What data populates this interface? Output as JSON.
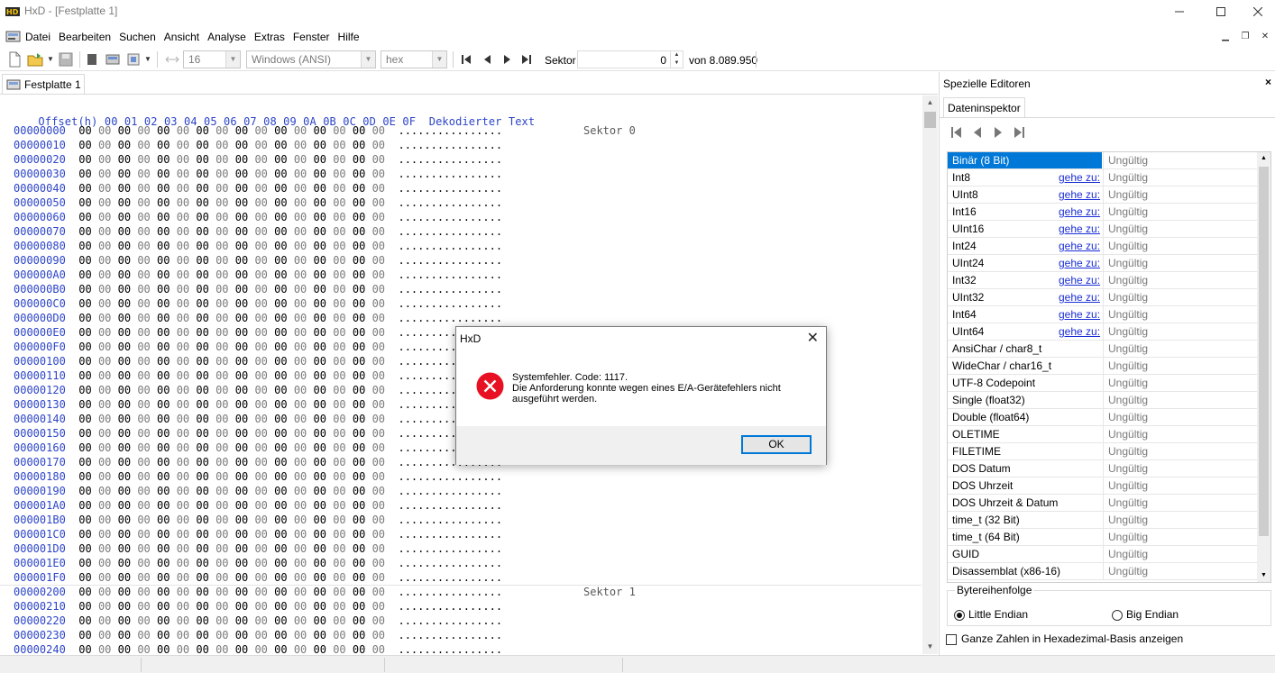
{
  "window": {
    "title": "HxD - [Festplatte 1]"
  },
  "colors": {
    "accent": "#0078d7",
    "offset_blue": "#2c44c8",
    "link_blue": "#1a2ed6",
    "error_red": "#e81123"
  },
  "menu": {
    "items": [
      "Datei",
      "Bearbeiten",
      "Suchen",
      "Ansicht",
      "Analyse",
      "Extras",
      "Fenster",
      "Hilfe"
    ]
  },
  "toolbar": {
    "bytes_per_row": "16",
    "charset": "Windows (ANSI)",
    "number_base": "hex",
    "sector_label": "Sektor",
    "sector_value": "0",
    "sector_total": "von 8.089.950"
  },
  "document_tab": {
    "label": "Festplatte 1"
  },
  "hex_view": {
    "header_offset": "Offset(h)",
    "header_columns": [
      "00",
      "01",
      "02",
      "03",
      "04",
      "05",
      "06",
      "07",
      "08",
      "09",
      "0A",
      "0B",
      "0C",
      "0D",
      "0E",
      "0F"
    ],
    "header_decoded": "Dekodierter Text",
    "byte_value": "00",
    "decoded_text": "................",
    "offsets": [
      "00000000",
      "00000010",
      "00000020",
      "00000030",
      "00000040",
      "00000050",
      "00000060",
      "00000070",
      "00000080",
      "00000090",
      "000000A0",
      "000000B0",
      "000000C0",
      "000000D0",
      "000000E0",
      "000000F0",
      "00000100",
      "00000110",
      "00000120",
      "00000130",
      "00000140",
      "00000150",
      "00000160",
      "00000170",
      "00000180",
      "00000190",
      "000001A0",
      "000001B0",
      "000001C0",
      "000001D0",
      "000001E0",
      "000001F0",
      "00000200",
      "00000210",
      "00000220",
      "00000230",
      "00000240"
    ],
    "sector_labels": [
      "Sektor 0",
      "Sektor 1"
    ]
  },
  "panel": {
    "title": "Spezielle Editoren",
    "close": "×",
    "tab": "Dateninspektor",
    "goto_label": "gehe zu:",
    "rows": [
      {
        "name": "Binär (8 Bit)",
        "value": "Ungültig",
        "selected": true,
        "goto": false
      },
      {
        "name": "Int8",
        "value": "Ungültig",
        "goto": true
      },
      {
        "name": "UInt8",
        "value": "Ungültig",
        "goto": true
      },
      {
        "name": "Int16",
        "value": "Ungültig",
        "goto": true
      },
      {
        "name": "UInt16",
        "value": "Ungültig",
        "goto": true
      },
      {
        "name": "Int24",
        "value": "Ungültig",
        "goto": true
      },
      {
        "name": "UInt24",
        "value": "Ungültig",
        "goto": true
      },
      {
        "name": "Int32",
        "value": "Ungültig",
        "goto": true
      },
      {
        "name": "UInt32",
        "value": "Ungültig",
        "goto": true
      },
      {
        "name": "Int64",
        "value": "Ungültig",
        "goto": true
      },
      {
        "name": "UInt64",
        "value": "Ungültig",
        "goto": true
      },
      {
        "name": "AnsiChar / char8_t",
        "value": "Ungültig",
        "goto": false
      },
      {
        "name": "WideChar / char16_t",
        "value": "Ungültig",
        "goto": false
      },
      {
        "name": "UTF-8 Codepoint",
        "value": "Ungültig",
        "goto": false
      },
      {
        "name": "Single (float32)",
        "value": "Ungültig",
        "goto": false
      },
      {
        "name": "Double (float64)",
        "value": "Ungültig",
        "goto": false
      },
      {
        "name": "OLETIME",
        "value": "Ungültig",
        "goto": false
      },
      {
        "name": "FILETIME",
        "value": "Ungültig",
        "goto": false
      },
      {
        "name": "DOS Datum",
        "value": "Ungültig",
        "goto": false
      },
      {
        "name": "DOS Uhrzeit",
        "value": "Ungültig",
        "goto": false
      },
      {
        "name": "DOS Uhrzeit & Datum",
        "value": "Ungültig",
        "goto": false
      },
      {
        "name": "time_t (32 Bit)",
        "value": "Ungültig",
        "goto": false
      },
      {
        "name": "time_t (64 Bit)",
        "value": "Ungültig",
        "goto": false
      },
      {
        "name": "GUID",
        "value": "Ungültig",
        "goto": false
      },
      {
        "name": "Disassemblat (x86-16)",
        "value": "Ungültig",
        "goto": false
      }
    ],
    "byte_order": {
      "title": "Bytereihenfolge",
      "little": "Little Endian",
      "big": "Big Endian",
      "selected": "little"
    },
    "hex_basis_label": "Ganze Zahlen in Hexadezimal-Basis anzeigen",
    "hex_basis_checked": false
  },
  "dialog": {
    "title": "HxD",
    "close": "✕",
    "line1": "Systemfehler.  Code: 1117.",
    "line2": "Die Anforderung konnte wegen eines E/A-Gerätefehlers nicht",
    "line3": "ausgeführt werden.",
    "ok_label": "OK"
  }
}
